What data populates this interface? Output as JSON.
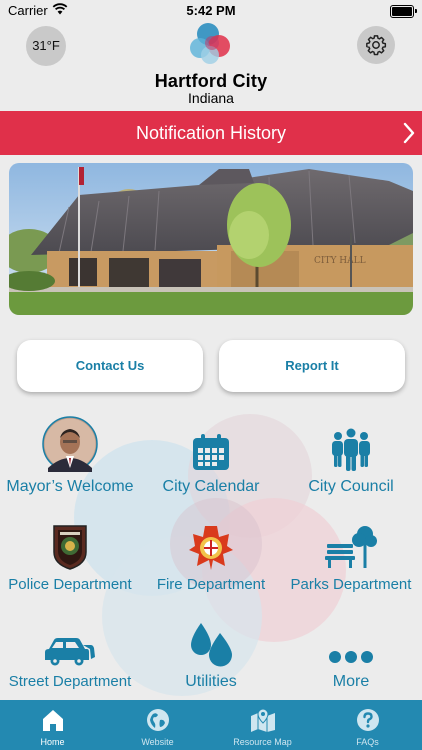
{
  "status_bar": {
    "carrier": "Carrier",
    "time": "5:42 PM"
  },
  "header": {
    "temperature": "31°F",
    "city_name": "Hartford City",
    "state": "Indiana"
  },
  "notification_bar": {
    "label": "Notification History"
  },
  "hero": {
    "sign_text": "CITY HALL"
  },
  "actions": {
    "contact_label": "Contact Us",
    "report_label": "Report It"
  },
  "grid": [
    {
      "label": "Mayor’s Welcome",
      "icon": "mayor-photo"
    },
    {
      "label": "City Calendar",
      "icon": "calendar-icon"
    },
    {
      "label": "City Council",
      "icon": "people-icon"
    },
    {
      "label": "Police Department",
      "icon": "police-badge-icon"
    },
    {
      "label": "Fire Department",
      "icon": "fire-emblem-icon"
    },
    {
      "label": "Parks Department",
      "icon": "park-bench-icon"
    },
    {
      "label": "Street Department",
      "icon": "car-icon"
    },
    {
      "label": "Utilities",
      "icon": "water-drops-icon"
    },
    {
      "label": "More",
      "icon": "more-dots-icon"
    }
  ],
  "tabs": [
    {
      "label": "Home",
      "icon": "home-icon",
      "active": true
    },
    {
      "label": "Website",
      "icon": "globe-icon",
      "active": false
    },
    {
      "label": "Resource Map",
      "icon": "map-icon",
      "active": false
    },
    {
      "label": "FAQs",
      "icon": "question-icon",
      "active": false
    }
  ],
  "colors": {
    "accent": "#1a7fa6",
    "notification": "#e0304a",
    "tabbar": "#2389b1",
    "background": "#ececec"
  }
}
